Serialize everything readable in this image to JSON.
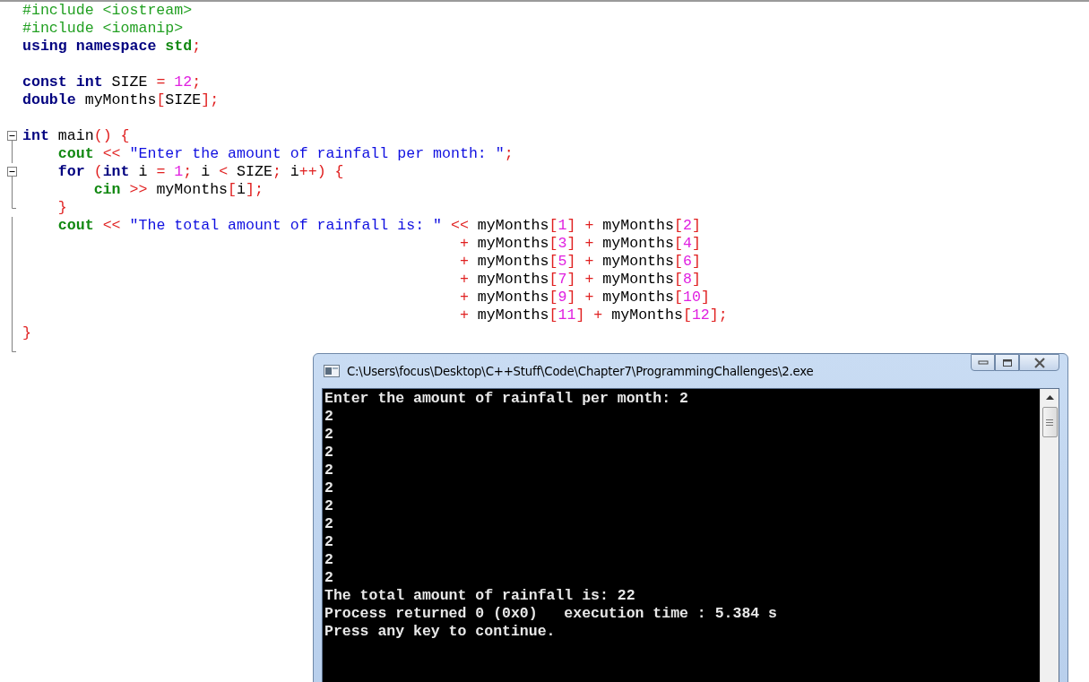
{
  "editor": {
    "lines": [
      {
        "kind": "plain",
        "tokens": [
          {
            "kind": "preproc",
            "text": "#include <iostream>"
          }
        ]
      },
      {
        "kind": "plain",
        "tokens": [
          {
            "kind": "preproc",
            "text": "#include <iomanip>"
          }
        ]
      },
      {
        "kind": "plain",
        "tokens": [
          {
            "kind": "keyword",
            "text": "using"
          },
          {
            "kind": "keyword",
            "text": " namespace"
          },
          {
            "kind": "library",
            "text": " std"
          },
          {
            "kind": "operator",
            "text": ";"
          }
        ]
      },
      {
        "kind": "plain"
      },
      {
        "kind": "plain",
        "tokens": [
          {
            "kind": "keyword",
            "text": "const"
          },
          {
            "kind": "keyword",
            "text": " int"
          },
          {
            "kind": "plain",
            "text": " SIZE"
          },
          {
            "kind": "operator",
            "text": " ="
          },
          {
            "kind": "number",
            "text": " 12"
          },
          {
            "kind": "operator",
            "text": ";"
          }
        ]
      },
      {
        "kind": "plain",
        "tokens": [
          {
            "kind": "keyword",
            "text": "double"
          },
          {
            "kind": "plain",
            "text": " myMonths"
          },
          {
            "kind": "operator",
            "text": "["
          },
          {
            "kind": "plain",
            "text": "SIZE"
          },
          {
            "kind": "operator",
            "text": "];"
          }
        ]
      },
      {
        "kind": "plain"
      },
      {
        "kind": "fold-start",
        "expanded": true,
        "tokens": [
          {
            "kind": "keyword",
            "text": "int"
          },
          {
            "kind": "plain",
            "text": " main"
          },
          {
            "kind": "operator",
            "text": "()"
          },
          {
            "kind": "operator",
            "text": " {"
          }
        ]
      },
      {
        "kind": "fold-body",
        "tokens": [
          {
            "kind": "library",
            "text": "    cout"
          },
          {
            "kind": "operator",
            "text": " <<"
          },
          {
            "kind": "string",
            "text": " \"Enter the amount of rainfall per month: \""
          },
          {
            "kind": "operator",
            "text": ";"
          }
        ]
      },
      {
        "kind": "fold-start",
        "expanded": true,
        "tokens": [
          {
            "kind": "keyword",
            "text": "    for"
          },
          {
            "kind": "operator",
            "text": " ("
          },
          {
            "kind": "keyword",
            "text": "int"
          },
          {
            "kind": "plain",
            "text": " i"
          },
          {
            "kind": "operator",
            "text": " ="
          },
          {
            "kind": "number",
            "text": " 1"
          },
          {
            "kind": "operator",
            "text": ";"
          },
          {
            "kind": "plain",
            "text": " i"
          },
          {
            "kind": "operator",
            "text": " <"
          },
          {
            "kind": "plain",
            "text": " SIZE"
          },
          {
            "kind": "operator",
            "text": ";"
          },
          {
            "kind": "plain",
            "text": " i"
          },
          {
            "kind": "operator",
            "text": "++)"
          },
          {
            "kind": "operator",
            "text": " {"
          }
        ]
      },
      {
        "kind": "fold-body",
        "tokens": [
          {
            "kind": "library",
            "text": "        cin"
          },
          {
            "kind": "operator",
            "text": " >>"
          },
          {
            "kind": "plain",
            "text": " myMonths"
          },
          {
            "kind": "operator",
            "text": "["
          },
          {
            "kind": "plain",
            "text": "i"
          },
          {
            "kind": "operator",
            "text": "];"
          }
        ]
      },
      {
        "kind": "fold-end",
        "tokens": [
          {
            "kind": "operator",
            "text": "    }"
          }
        ]
      },
      {
        "kind": "fold-body",
        "tokens": [
          {
            "kind": "library",
            "text": "    cout"
          },
          {
            "kind": "operator",
            "text": " <<"
          },
          {
            "kind": "string",
            "text": " \"The total amount of rainfall is: \""
          },
          {
            "kind": "operator",
            "text": " <<"
          },
          {
            "kind": "plain",
            "text": " myMonths"
          },
          {
            "kind": "operator",
            "text": "["
          },
          {
            "kind": "number",
            "text": "1"
          },
          {
            "kind": "operator",
            "text": "]"
          },
          {
            "kind": "operator",
            "text": " +"
          },
          {
            "kind": "plain",
            "text": " myMonths"
          },
          {
            "kind": "operator",
            "text": "["
          },
          {
            "kind": "number",
            "text": "2"
          },
          {
            "kind": "operator",
            "text": "]"
          }
        ]
      },
      {
        "kind": "fold-body",
        "tokens": [
          {
            "kind": "operator",
            "text": "                                                 +"
          },
          {
            "kind": "plain",
            "text": " myMonths"
          },
          {
            "kind": "operator",
            "text": "["
          },
          {
            "kind": "number",
            "text": "3"
          },
          {
            "kind": "operator",
            "text": "]"
          },
          {
            "kind": "operator",
            "text": " +"
          },
          {
            "kind": "plain",
            "text": " myMonths"
          },
          {
            "kind": "operator",
            "text": "["
          },
          {
            "kind": "number",
            "text": "4"
          },
          {
            "kind": "operator",
            "text": "]"
          }
        ]
      },
      {
        "kind": "fold-body",
        "tokens": [
          {
            "kind": "operator",
            "text": "                                                 +"
          },
          {
            "kind": "plain",
            "text": " myMonths"
          },
          {
            "kind": "operator",
            "text": "["
          },
          {
            "kind": "number",
            "text": "5"
          },
          {
            "kind": "operator",
            "text": "]"
          },
          {
            "kind": "operator",
            "text": " +"
          },
          {
            "kind": "plain",
            "text": " myMonths"
          },
          {
            "kind": "operator",
            "text": "["
          },
          {
            "kind": "number",
            "text": "6"
          },
          {
            "kind": "operator",
            "text": "]"
          }
        ]
      },
      {
        "kind": "fold-body",
        "tokens": [
          {
            "kind": "operator",
            "text": "                                                 +"
          },
          {
            "kind": "plain",
            "text": " myMonths"
          },
          {
            "kind": "operator",
            "text": "["
          },
          {
            "kind": "number",
            "text": "7"
          },
          {
            "kind": "operator",
            "text": "]"
          },
          {
            "kind": "operator",
            "text": " +"
          },
          {
            "kind": "plain",
            "text": " myMonths"
          },
          {
            "kind": "operator",
            "text": "["
          },
          {
            "kind": "number",
            "text": "8"
          },
          {
            "kind": "operator",
            "text": "]"
          }
        ]
      },
      {
        "kind": "fold-body",
        "tokens": [
          {
            "kind": "operator",
            "text": "                                                 +"
          },
          {
            "kind": "plain",
            "text": " myMonths"
          },
          {
            "kind": "operator",
            "text": "["
          },
          {
            "kind": "number",
            "text": "9"
          },
          {
            "kind": "operator",
            "text": "]"
          },
          {
            "kind": "operator",
            "text": " +"
          },
          {
            "kind": "plain",
            "text": " myMonths"
          },
          {
            "kind": "operator",
            "text": "["
          },
          {
            "kind": "number",
            "text": "10"
          },
          {
            "kind": "operator",
            "text": "]"
          }
        ]
      },
      {
        "kind": "fold-body",
        "tokens": [
          {
            "kind": "operator",
            "text": "                                                 +"
          },
          {
            "kind": "plain",
            "text": " myMonths"
          },
          {
            "kind": "operator",
            "text": "["
          },
          {
            "kind": "number",
            "text": "11"
          },
          {
            "kind": "operator",
            "text": "]"
          },
          {
            "kind": "operator",
            "text": " +"
          },
          {
            "kind": "plain",
            "text": " myMonths"
          },
          {
            "kind": "operator",
            "text": "["
          },
          {
            "kind": "number",
            "text": "12"
          },
          {
            "kind": "operator",
            "text": "];"
          }
        ]
      },
      {
        "kind": "fold-body",
        "tokens": [
          {
            "kind": "operator",
            "text": "}"
          }
        ]
      },
      {
        "kind": "fold-end"
      }
    ]
  },
  "console": {
    "title": "C:\\Users\\focus\\Desktop\\C++Stuff\\Code\\Chapter7\\ProgrammingChallenges\\2.exe",
    "output": [
      "Enter the amount of rainfall per month: 2",
      "2",
      "2",
      "2",
      "2",
      "2",
      "2",
      "2",
      "2",
      "2",
      "2",
      "The total amount of rainfall is: 22",
      "Process returned 0 (0x0)   execution time : 5.384 s",
      "Press any key to continue."
    ]
  }
}
